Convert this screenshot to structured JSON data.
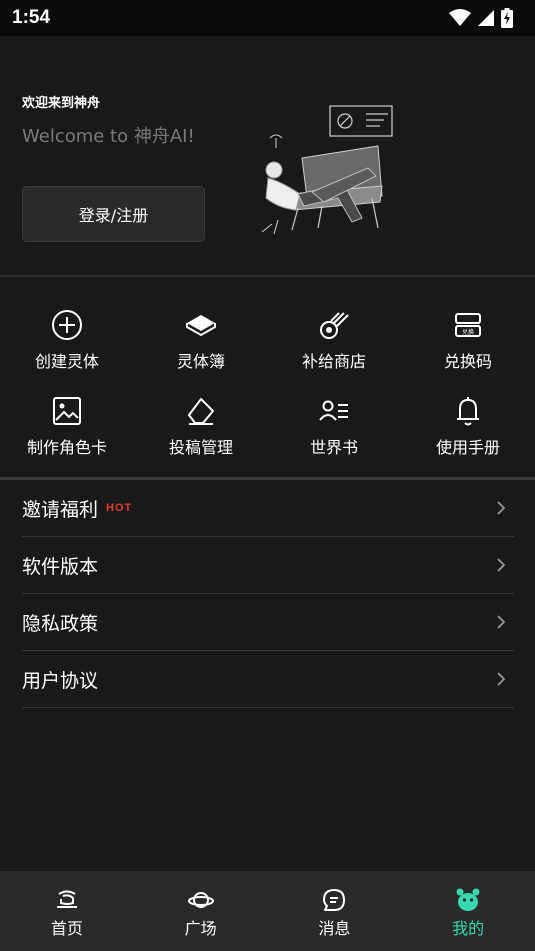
{
  "status_bar": {
    "time": "1:54"
  },
  "header": {
    "welcome_title": "欢迎来到神舟",
    "welcome_sub": "Welcome to 神舟AI!",
    "login_label": "登录/注册"
  },
  "grid": [
    {
      "label": "创建灵体",
      "icon": "plus-circle-icon"
    },
    {
      "label": "灵体簿",
      "icon": "book-icon"
    },
    {
      "label": "补给商店",
      "icon": "comet-icon"
    },
    {
      "label": "兑换码",
      "icon": "redeem-ticket-icon"
    },
    {
      "label": "制作角色卡",
      "icon": "image-card-icon"
    },
    {
      "label": "投稿管理",
      "icon": "eraser-icon"
    },
    {
      "label": "世界书",
      "icon": "person-list-icon"
    },
    {
      "label": "使用手册",
      "icon": "bell-icon"
    }
  ],
  "redeem_icon_text": "兑换",
  "menu": [
    {
      "label": "邀请福利",
      "badge": "HOT"
    },
    {
      "label": "软件版本"
    },
    {
      "label": "隐私政策"
    },
    {
      "label": "用户协议"
    }
  ],
  "nav": [
    {
      "label": "首页",
      "icon": "home-icon",
      "active": false
    },
    {
      "label": "广场",
      "icon": "planet-icon",
      "active": false
    },
    {
      "label": "消息",
      "icon": "message-icon",
      "active": false
    },
    {
      "label": "我的",
      "icon": "bear-face-icon",
      "active": true
    }
  ],
  "colors": {
    "accent": "#35d8b0",
    "hot": "#e0402a",
    "background": "#191919"
  }
}
